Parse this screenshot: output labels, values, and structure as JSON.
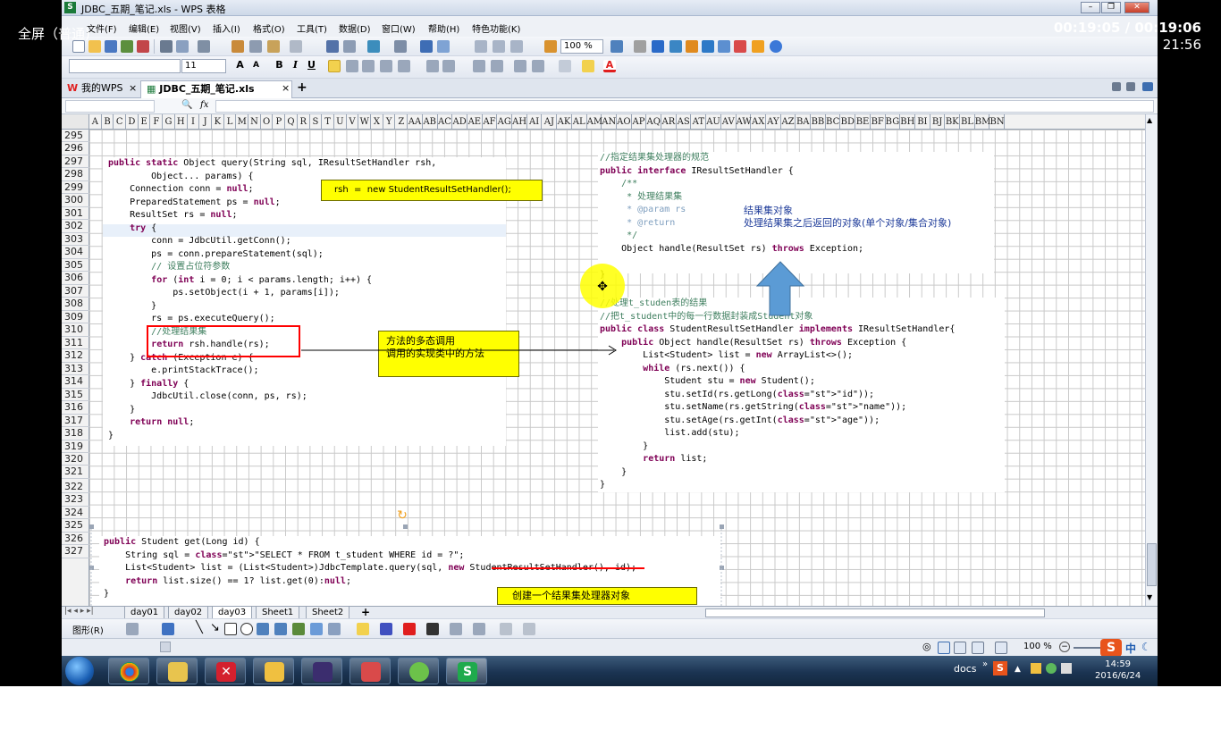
{
  "overlay": {
    "left_label": "全屏（普通)",
    "elapsed": "00:19:05 / 00:19:06",
    "clock": "21:56"
  },
  "titlebar": {
    "app_badge": "S",
    "title": "JDBC_五期_笔记.xls - WPS 表格"
  },
  "menu": [
    "文件(F)",
    "编辑(E)",
    "视图(V)",
    "插入(I)",
    "格式(O)",
    "工具(T)",
    "数据(D)",
    "窗口(W)",
    "帮助(H)",
    "特色功能(K)"
  ],
  "toolbar": {
    "zoom": "100 %"
  },
  "format_toolbar": {
    "font_size": "11",
    "bold": "B",
    "italic": "I",
    "underline": "U",
    "grow": "A",
    "shrink": "A"
  },
  "tabs": {
    "home_tab": "我的WPS",
    "doc_tab": "JDBC_五期_笔记.xls",
    "close": "×",
    "add": "+"
  },
  "formula_bar": {
    "fx": "fx"
  },
  "columns": [
    "A",
    "B",
    "C",
    "D",
    "E",
    "F",
    "G",
    "H",
    "I",
    "J",
    "K",
    "L",
    "M",
    "N",
    "O",
    "P",
    "Q",
    "R",
    "S",
    "T",
    "U",
    "V",
    "W",
    "X",
    "Y",
    "Z",
    "AA",
    "AB",
    "AC",
    "AD",
    "AE",
    "AF",
    "AG",
    "AH",
    "AI",
    "AJ",
    "AK",
    "AL",
    "AM",
    "AN",
    "AO",
    "AP",
    "AQ",
    "AR",
    "AS",
    "AT",
    "AU",
    "AV",
    "AW",
    "AX",
    "AY",
    "AZ",
    "BA",
    "BB",
    "BC",
    "BD",
    "BE",
    "BF",
    "BG",
    "BH",
    "BI",
    "BJ",
    "BK",
    "BL",
    "BM",
    "BN"
  ],
  "rows": [
    "295",
    "296",
    "297",
    "298",
    "299",
    "300",
    "301",
    "302",
    "303",
    "304",
    "305",
    "306",
    "307",
    "308",
    "309",
    "310",
    "311",
    "312",
    "313",
    "314",
    "315",
    "316",
    "317",
    "318",
    "319",
    "320",
    "321",
    "322",
    "323",
    "324",
    "325",
    "326",
    "327"
  ],
  "code_query": [
    "public static Object query(String sql, IResultSetHandler rsh,",
    "        Object... params) {",
    "    Connection conn = null;",
    "    PreparedStatement ps = null;",
    "    ResultSet rs = null;",
    "    try {",
    "        conn = JdbcUtil.getConn();",
    "        ps = conn.prepareStatement(sql);",
    "        // 设置占位符参数",
    "        for (int i = 0; i < params.length; i++) {",
    "            ps.setObject(i + 1, params[i]);",
    "        }",
    "        rs = ps.executeQuery();",
    "        //处理结果集",
    "        return rsh.handle(rs);",
    "    } catch (Exception e) {",
    "        e.printStackTrace();",
    "    } finally {",
    "        JdbcUtil.close(conn, ps, rs);",
    "    }",
    "    return null;",
    "}"
  ],
  "code_interface": [
    "//指定结果集处理器的规范",
    "public interface IResultSetHandler {",
    "    /**",
    "     * 处理结果集",
    "     * @param rs",
    "     * @return",
    "     */",
    "    Object handle(ResultSet rs) throws Exception;",
    "",
    "}"
  ],
  "interface_notes": {
    "line1": "结果集对象",
    "line2": "处理结果集之后返回的对象(单个对象/集合对象)"
  },
  "code_impl": [
    "//处理t_studen表的结果",
    "//把t_student中的每一行数据封装成Student对象",
    "public class StudentResultSetHandler implements IResultSetHandler{",
    "    public Object handle(ResultSet rs) throws Exception {",
    "        List<Student> list = new ArrayList<>();",
    "        while (rs.next()) {",
    "            Student stu = new Student();",
    "            stu.setId(rs.getLong(\"id\"));",
    "            stu.setName(rs.getString(\"name\"));",
    "            stu.setAge(rs.getInt(\"age\"));",
    "            list.add(stu);",
    "        }",
    "        return list;",
    "    }",
    "}"
  ],
  "code_get": [
    "public Student get(Long id) {",
    "    String sql = \"SELECT * FROM t_student WHERE id = ?\";",
    "    List<Student> list = (List<Student>)JdbcTemplate.query(sql, new StudentResultSetHandler(), id);",
    "    return list.size() == 1? list.get(0):null;",
    "}"
  ],
  "notes": {
    "rsh": "rsh  =  new StudentResultSetHandler();",
    "poly": "方法的多态调用\n调用的实现类中的方法",
    "create": "创建一个结果集处理器对象"
  },
  "sheets": [
    "day01",
    "day02",
    "day03",
    "Sheet1",
    "Sheet2"
  ],
  "active_sheet": "day03",
  "drawbar": {
    "label": "图形(R)"
  },
  "statusbar": {
    "zoom": "100 %"
  },
  "taskbar": {
    "tray_label": "docs",
    "time": "14:59",
    "date": "2016/6/24"
  },
  "colors": {
    "note_yellow": "#ffff00",
    "highlight_red": "#ff0000",
    "arrow_blue": "#5b9bd5",
    "cursor_yellow": "#ffff00"
  }
}
